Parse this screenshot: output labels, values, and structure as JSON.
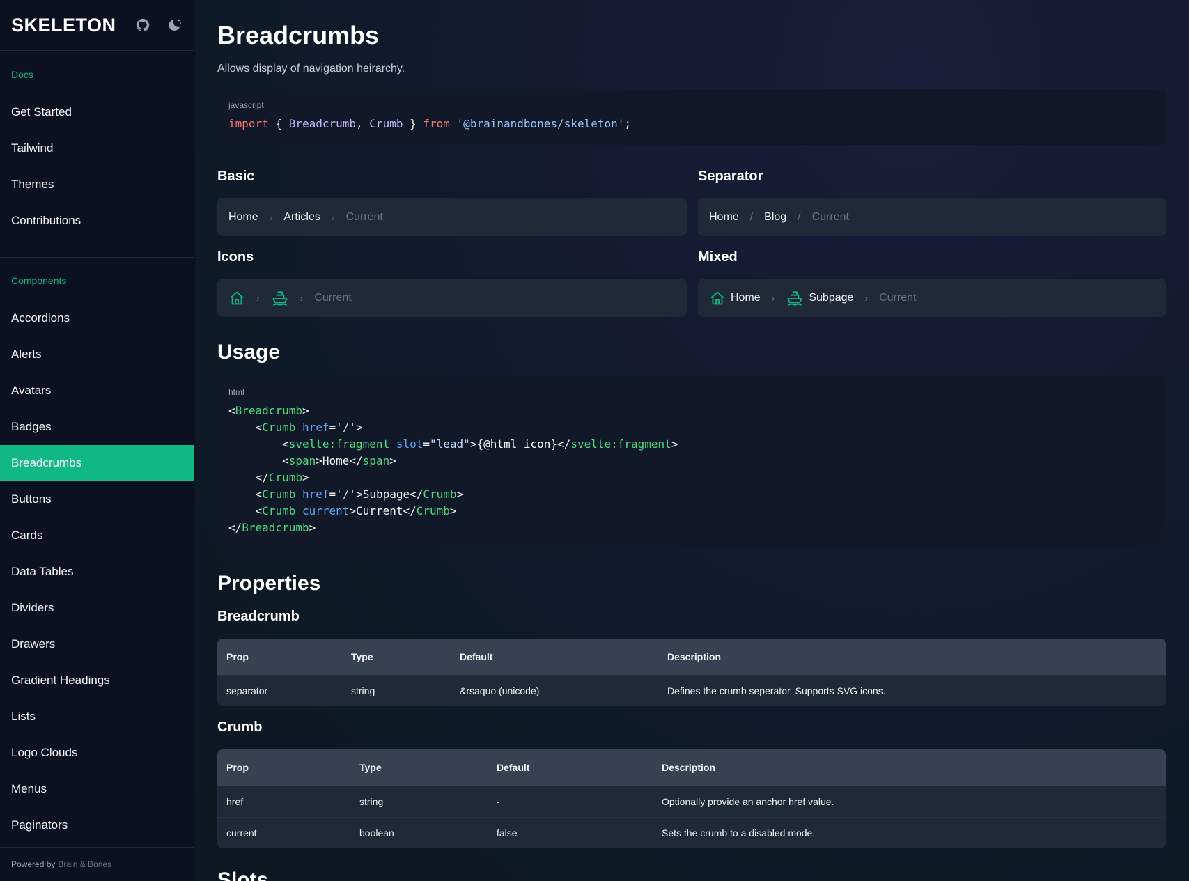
{
  "sidebar": {
    "brand": "SKELETON",
    "icons": [
      "github-icon",
      "moon-icon"
    ],
    "docs_label": "Docs",
    "docs_items": [
      "Get Started",
      "Tailwind",
      "Themes",
      "Contributions"
    ],
    "components_label": "Components",
    "component_items": [
      "Accordions",
      "Alerts",
      "Avatars",
      "Badges",
      "Breadcrumbs",
      "Buttons",
      "Cards",
      "Data Tables",
      "Dividers",
      "Drawers",
      "Gradient Headings",
      "Lists",
      "Logo Clouds",
      "Menus",
      "Paginators"
    ],
    "active_item": "Breadcrumbs",
    "footer_prefix": "Powered by",
    "footer_link": "Brain & Bones"
  },
  "page": {
    "title": "Breadcrumbs",
    "subtitle": "Allows display of navigation heirarchy."
  },
  "import_code": {
    "lang": "javascript",
    "kw_import": "import",
    "brace_open": " { ",
    "name1": "Breadcrumb",
    "comma": ", ",
    "name2": "Crumb",
    "brace_close": " } ",
    "kw_from": "from",
    "space": " ",
    "module": "'@brainandbones/skeleton'",
    "semi": ";"
  },
  "examples": {
    "basic": {
      "title": "Basic",
      "crumbs": [
        "Home",
        "Articles",
        "Current"
      ],
      "separator": "›"
    },
    "separator": {
      "title": "Separator",
      "crumbs": [
        "Home",
        "Blog",
        "Current"
      ],
      "separator": "/"
    },
    "icons": {
      "title": "Icons",
      "current": "Current",
      "separator": "›"
    },
    "mixed": {
      "title": "Mixed",
      "crumbs": [
        "Home",
        "Subpage",
        "Current"
      ],
      "separator": "›"
    }
  },
  "usage": {
    "title": "Usage",
    "lang": "html",
    "lines": [
      "<Breadcrumb>",
      "    <Crumb href='/'>",
      "        <svelte:fragment slot=\"lead\">{@html icon}</svelte:fragment>",
      "        <span>Home</span>",
      "    </Crumb>",
      "    <Crumb href='/'>Subpage</Crumb>",
      "    <Crumb current>Current</Crumb>",
      "</Breadcrumb>"
    ]
  },
  "properties": {
    "title": "Properties",
    "breadcrumb_table": {
      "title": "Breadcrumb",
      "headers": [
        "Prop",
        "Type",
        "Default",
        "Description"
      ],
      "rows": [
        [
          "separator",
          "string",
          "&rsaquo (unicode)",
          "Defines the crumb seperator. Supports SVG icons."
        ]
      ]
    },
    "crumb_table": {
      "title": "Crumb",
      "headers": [
        "Prop",
        "Type",
        "Default",
        "Description"
      ],
      "rows": [
        [
          "href",
          "string",
          "-",
          "Optionally provide an anchor href value."
        ],
        [
          "current",
          "boolean",
          "false",
          "Sets the crumb to a disabled mode."
        ]
      ]
    }
  },
  "next_section": "Slots",
  "colors": {
    "accent": "#10b981",
    "background": "#0b1120",
    "panel": "#1f2937",
    "table_header": "#374151"
  }
}
